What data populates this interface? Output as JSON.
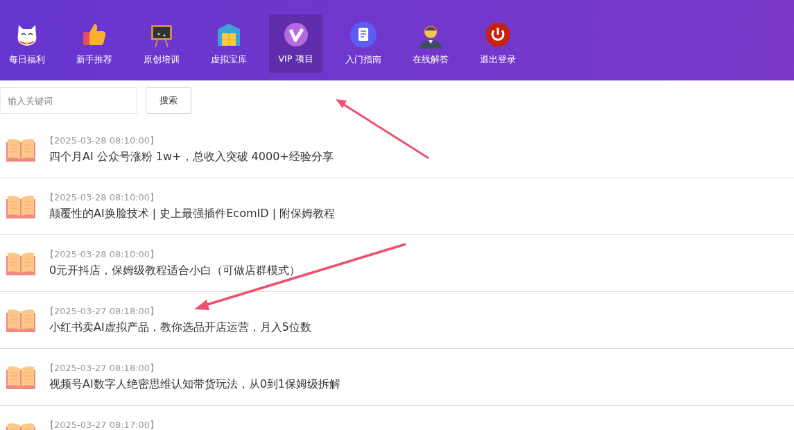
{
  "nav": [
    {
      "label": "每日福利",
      "kind": "cat",
      "selected": false
    },
    {
      "label": "新手推荐",
      "kind": "thumb",
      "selected": false
    },
    {
      "label": "原创培训",
      "kind": "board",
      "selected": false
    },
    {
      "label": "虚拟宝库",
      "kind": "warehouse",
      "selected": false
    },
    {
      "label": "VIP 项目",
      "kind": "vip",
      "selected": true
    },
    {
      "label": "入门指南",
      "kind": "doc",
      "selected": false
    },
    {
      "label": "在线解答",
      "kind": "agent",
      "selected": false
    },
    {
      "label": "退出登录",
      "kind": "power",
      "selected": false
    }
  ],
  "search": {
    "placeholder": "输入关键词",
    "button": "搜索"
  },
  "articles": [
    {
      "time": "【2025-03-28 08:10:00】",
      "title": "四个月AI 公众号涨粉 1w+，总收入突破 4000+经验分享"
    },
    {
      "time": "【2025-03-28 08:10:00】",
      "title": "颠覆性的AI换脸技术 | 史上最强插件EcomID | 附保姆教程"
    },
    {
      "time": "【2025-03-28 08:10:00】",
      "title": "0元开抖店，保姆级教程适合小白（可做店群模式）"
    },
    {
      "time": "【2025-03-27 08:18:00】",
      "title": "小红书卖AI虚拟产品，教你选品开店运营，月入5位数"
    },
    {
      "time": "【2025-03-27 08:18:00】",
      "title": "视频号AI数字人绝密思维认知带货玩法，从0到1保姆级拆解"
    },
    {
      "time": "【2025-03-27 08:17:00】"
    }
  ]
}
